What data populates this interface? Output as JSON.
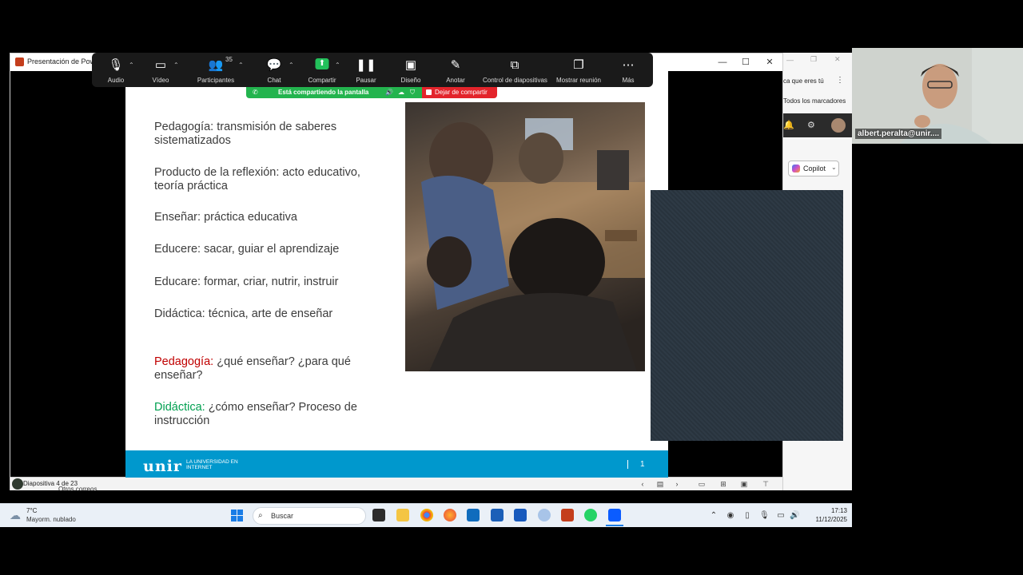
{
  "powerpoint": {
    "title": "Presentación de PowerPoint",
    "slide_counter": "Diapositiva 4 de 23"
  },
  "slide": {
    "items": [
      {
        "text": "Pedagogía: transmisión de saberes sistematizados"
      },
      {
        "text": "Producto de la reflexión: acto educativo, teoría práctica"
      },
      {
        "text": "Enseñar: práctica educativa"
      },
      {
        "text": "Educere: sacar, guiar el aprendizaje"
      },
      {
        "text": "Educare: formar, criar, nutrir, instruir"
      },
      {
        "text": "Didáctica: técnica, arte de enseñar"
      }
    ],
    "question1": {
      "term": "Pedagogía:",
      "rest": " ¿qué enseñar? ¿para qué enseñar?"
    },
    "question2": {
      "term": "Didáctica:",
      "rest": " ¿cómo enseñar? Proceso de instrucción"
    },
    "footer": {
      "logo": "unir",
      "tagline": "LA UNIVERSIDAD EN INTERNET",
      "slide_number": "1"
    }
  },
  "zoom_toolbar": {
    "items": [
      {
        "label": "Audio",
        "icon": "microphone-icon"
      },
      {
        "label": "Vídeo",
        "icon": "camera-icon"
      },
      {
        "label": "Participantes",
        "icon": "participants-icon",
        "count": "35"
      },
      {
        "label": "Chat",
        "icon": "chat-icon"
      },
      {
        "label": "Compartir",
        "icon": "share-icon"
      },
      {
        "label": "Pausar",
        "icon": "pause-icon"
      },
      {
        "label": "Diseño",
        "icon": "layout-icon"
      },
      {
        "label": "Anotar",
        "icon": "pencil-icon"
      },
      {
        "label": "Control de diapositivas",
        "icon": "slide-control-icon"
      },
      {
        "label": "Mostrar reunión",
        "icon": "show-meeting-icon"
      },
      {
        "label": "Más",
        "icon": "more-icon"
      }
    ],
    "share_banner": "Está compartiendo la pantalla",
    "stop_share": "Dejar de compartir"
  },
  "browser": {
    "text1": "ca que eres tú",
    "text2": "Todos los marcadores",
    "copilot": "Copilot"
  },
  "participant": {
    "name": "albert.peralta@unir...."
  },
  "taskbar": {
    "weather_temp": "7°C",
    "weather_desc": "Mayorm. nublado",
    "search_placeholder": "Buscar",
    "time": "17:13",
    "date": "11/12/2025"
  },
  "peek": {
    "text": "Otros correos"
  },
  "colors": {
    "accent_blue": "#0098cd",
    "share_green": "#23b44e",
    "stop_red": "#e3242b",
    "term_red": "#c00000",
    "term_green": "#00a050"
  }
}
